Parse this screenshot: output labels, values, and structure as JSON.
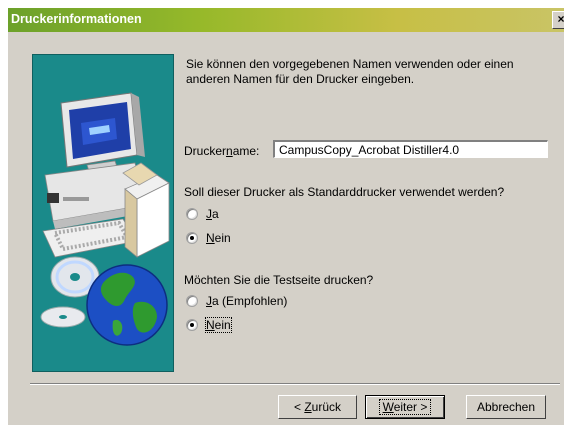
{
  "window": {
    "title": "Druckerinformationen",
    "close_glyph": "×"
  },
  "intro": "Sie können den vorgegebenen Namen verwenden oder einen anderen Namen für den Drucker eingeben.",
  "printer_name": {
    "label_prefix": "Drucker",
    "label_accel": "n",
    "label_suffix": "ame:",
    "value": "CampusCopy_Acrobat Distiller4.0"
  },
  "default_printer": {
    "question": "Soll dieser Drucker als Standarddrucker verwendet werden?",
    "options": [
      {
        "accel": "J",
        "rest": "a",
        "selected": false
      },
      {
        "accel": "N",
        "rest": "ein",
        "selected": true
      }
    ]
  },
  "test_page": {
    "question": "Möchten Sie die Testseite drucken?",
    "options": [
      {
        "accel": "J",
        "rest": "a (Empfohlen)",
        "selected": false
      },
      {
        "accel": "N",
        "rest": "ein",
        "selected": true
      }
    ]
  },
  "buttons": {
    "back": {
      "prefix": "< ",
      "accel": "Z",
      "rest": "urück"
    },
    "next": {
      "accel": "W",
      "rest": "eiter >"
    },
    "cancel": {
      "label": "Abbrechen"
    }
  },
  "icons": [
    "computer-illustration",
    "cd-icon",
    "globe-icon",
    "close-icon"
  ]
}
